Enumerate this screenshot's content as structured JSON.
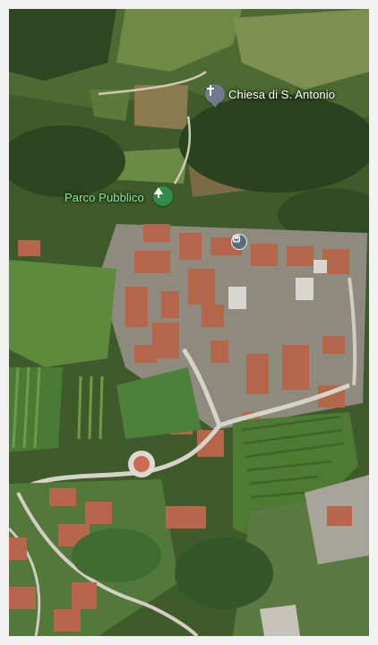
{
  "map": {
    "view": "satellite-3d",
    "places": [
      {
        "name": "Chiesa di S. Antonio",
        "icon": "church-cross-icon",
        "label_color": "#ffffff",
        "pin_color": "#6f7b8b"
      },
      {
        "name": "Parco Pubblico",
        "icon": "tree-icon",
        "label_color": "#8be3a0",
        "pin_color": "#2e8f4a"
      }
    ],
    "transit": {
      "icon": "bus-stop-icon",
      "pin_color": "#5d6a7a"
    }
  }
}
